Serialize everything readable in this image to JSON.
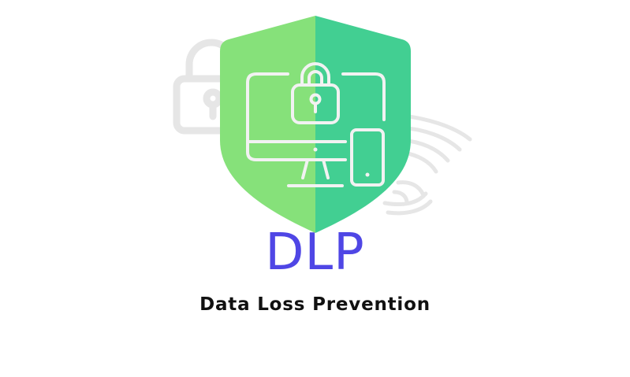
{
  "graphic": {
    "icon_names": [
      "background-padlock-icon",
      "background-fingerprint-icon",
      "shield-icon",
      "monitor-icon",
      "padlock-icon",
      "smartphone-icon"
    ],
    "colors": {
      "shield_left": "#86e17a",
      "shield_right": "#42cf92",
      "line_art": "#f2f2f2",
      "background_icons": "#e6e6e6"
    }
  },
  "heading": {
    "acronym": "DLP",
    "acronym_color": "#4f46e5",
    "subtitle": "Data Loss Prevention",
    "subtitle_color": "#111111"
  }
}
